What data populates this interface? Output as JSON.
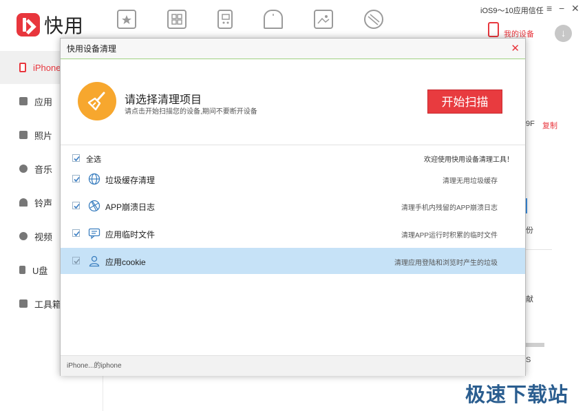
{
  "app": {
    "logo_text": "快用"
  },
  "topbar": {
    "nav_icons": [
      "star-icon",
      "apps-icon",
      "gamepad-icon",
      "bell-icon",
      "picture-icon",
      "wallpaper-icon"
    ],
    "ios_trust": "iOS9～10应用信任",
    "minimize": "−",
    "close": "✕",
    "my_device": "我的设备",
    "download": "↓"
  },
  "sidebar": {
    "items": [
      {
        "label": "iPhone",
        "icon": "phone-icon"
      },
      {
        "label": "应用",
        "icon": "apps-icon"
      },
      {
        "label": "照片",
        "icon": "photo-icon"
      },
      {
        "label": "音乐",
        "icon": "music-icon"
      },
      {
        "label": "铃声",
        "icon": "bell-icon"
      },
      {
        "label": "视频",
        "icon": "video-icon"
      },
      {
        "label": "U盘",
        "icon": "usb-icon"
      },
      {
        "label": "工具箱",
        "icon": "toolbox-icon"
      }
    ]
  },
  "background": {
    "copy_link": "复制",
    "partial_a": "9F",
    "partial_b": "份",
    "partial_c": "献",
    "partial_d": "S"
  },
  "dialog": {
    "title": "快用设备清理",
    "close": "✕",
    "header_title": "请选择清理项目",
    "header_sub": "请点击开始扫描您的设备,期间不要断开设备",
    "scan_button": "开始扫描",
    "select_all": "全选",
    "welcome": "欢迎使用快用设备清理工具！",
    "items": [
      {
        "label": "垃圾缓存清理",
        "desc": "清理无用垃圾缓存",
        "icon": "globe-icon",
        "checked": true
      },
      {
        "label": "APP崩溃日志",
        "desc": "清理手机内残留的APP崩溃日志",
        "icon": "aperture-icon",
        "checked": true
      },
      {
        "label": "应用临时文件",
        "desc": "清理APP运行时积累的临时文件",
        "icon": "chat-icon",
        "checked": true
      },
      {
        "label": "应用cookie",
        "desc": "清理应用登陆和浏览时产生的垃圾",
        "icon": "user-icon",
        "checked": true
      }
    ],
    "footer": "iPhone...的iphone"
  },
  "watermark": "极速下载站",
  "colors": {
    "accent": "#e8363d",
    "selected_row": "#c6e2f7",
    "broom": "#f7a72e"
  }
}
